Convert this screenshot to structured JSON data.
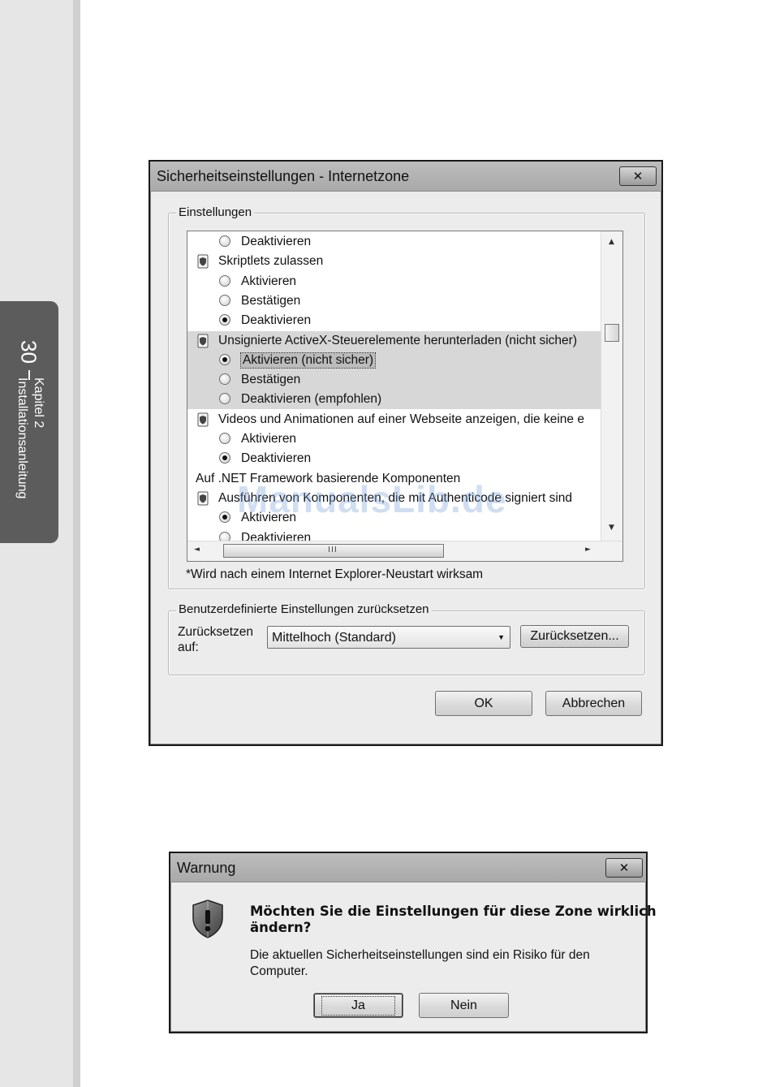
{
  "page": {
    "chapter_number": "30",
    "chapter_title": "Kapitel 2",
    "chapter_subtitle": "Installationsanleitung",
    "watermark": "ManualsLib.de"
  },
  "security_dialog": {
    "title": "Sicherheitseinstellungen - Internetzone",
    "close_glyph": "✕",
    "settings_group_label": "Einstellungen",
    "settings_rows": [
      {
        "kind": "radio",
        "label": "Deaktivieren",
        "checked": false,
        "highlight": false
      },
      {
        "kind": "header",
        "label": "Skriptlets zulassen",
        "highlight": false
      },
      {
        "kind": "radio",
        "label": "Aktivieren",
        "checked": false,
        "highlight": false
      },
      {
        "kind": "radio",
        "label": "Bestätigen",
        "checked": false,
        "highlight": false
      },
      {
        "kind": "radio",
        "label": "Deaktivieren",
        "checked": true,
        "highlight": false
      },
      {
        "kind": "header",
        "label": "Unsignierte ActiveX-Steuerelemente herunterladen (nicht sicher)",
        "highlight": true
      },
      {
        "kind": "radio",
        "label": "Aktivieren (nicht sicher)",
        "checked": true,
        "highlight": true,
        "focused": true
      },
      {
        "kind": "radio",
        "label": "Bestätigen",
        "checked": false,
        "highlight": true
      },
      {
        "kind": "radio",
        "label": "Deaktivieren (empfohlen)",
        "checked": false,
        "highlight": true
      },
      {
        "kind": "header",
        "label": "Videos und Animationen auf einer Webseite anzeigen, die keine e",
        "highlight": false
      },
      {
        "kind": "radio",
        "label": "Aktivieren",
        "checked": false,
        "highlight": false
      },
      {
        "kind": "radio",
        "label": "Deaktivieren",
        "checked": true,
        "highlight": false
      },
      {
        "kind": "section",
        "label": "Auf .NET Framework basierende Komponenten",
        "highlight": false
      },
      {
        "kind": "header2",
        "label": "Ausführen von Komponenten, die mit Authenticode signiert sind",
        "highlight": false
      },
      {
        "kind": "radio",
        "label": "Aktivieren",
        "checked": true,
        "highlight": false
      },
      {
        "kind": "radio",
        "label": "Deaktivieren",
        "checked": false,
        "highlight": false
      }
    ],
    "restart_note": "*Wird nach einem Internet Explorer-Neustart wirksam",
    "reset_group_label": "Benutzerdefinierte Einstellungen zurücksetzen",
    "reset_label_line1": "Zurücksetzen",
    "reset_label_line2": "auf:",
    "reset_level_value": "Mittelhoch (Standard)",
    "reset_button": "Zurücksetzen...",
    "ok_button": "OK",
    "cancel_button": "Abbrechen",
    "scroll_up": "▲",
    "scroll_down": "▼",
    "scroll_left": "◄",
    "scroll_right": "►",
    "hscroll_grip": "III",
    "combo_arrow": "▼"
  },
  "warning_dialog": {
    "title": "Warnung",
    "close_glyph": "✕",
    "question_line1": "Möchten Sie die Einstellungen für diese Zone wirklich",
    "question_line2": "ändern?",
    "detail_line1": "Die aktuellen Sicherheitseinstellungen sind ein Risiko für den",
    "detail_line2": "Computer.",
    "yes_button": "Ja",
    "no_button": "Nein"
  },
  "colors": {
    "chapter_tab": "#5c5c5c",
    "dialog_bg": "#ececec",
    "highlight_row": "#d7d7d7"
  }
}
